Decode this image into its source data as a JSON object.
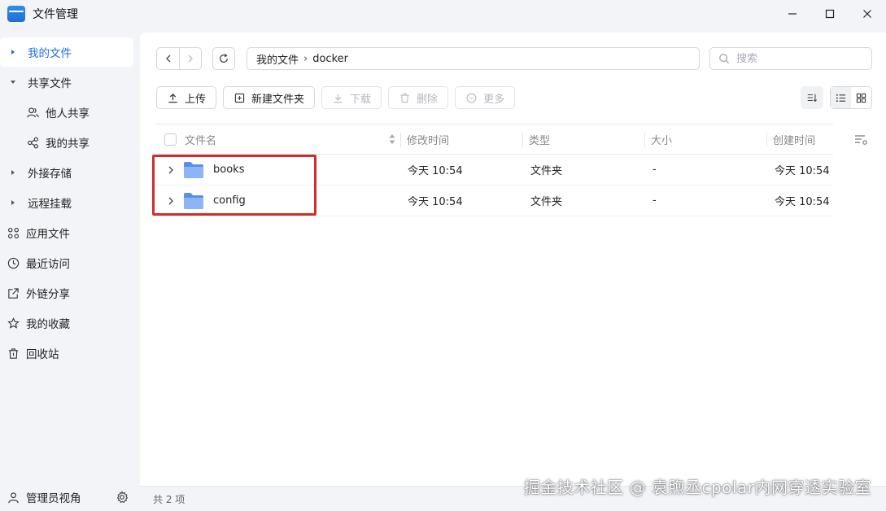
{
  "window": {
    "title": "文件管理",
    "controls": [
      "minimize",
      "maximize",
      "close"
    ]
  },
  "sidebar": {
    "items": [
      {
        "label": "我的文件",
        "icon": "caret-right-icon",
        "active": true
      },
      {
        "label": "共享文件",
        "icon": "caret-down-icon"
      },
      {
        "label": "他人共享",
        "icon": "users-icon",
        "sub": true
      },
      {
        "label": "我的共享",
        "icon": "share-icon",
        "sub": true
      },
      {
        "label": "外接存储",
        "icon": "caret-right-icon"
      },
      {
        "label": "远程挂载",
        "icon": "caret-right-icon"
      },
      {
        "label": "应用文件",
        "icon": "apps-icon"
      },
      {
        "label": "最近访问",
        "icon": "clock-icon"
      },
      {
        "label": "外链分享",
        "icon": "external-link-icon"
      },
      {
        "label": "我的收藏",
        "icon": "star-icon"
      },
      {
        "label": "回收站",
        "icon": "trash-icon"
      }
    ],
    "footer": {
      "label": "管理员视角",
      "icon": "admin-icon",
      "settings_icon": "gear-icon"
    }
  },
  "toolbar": {
    "path": {
      "root": "我的文件",
      "current": "docker"
    },
    "search_placeholder": "搜索",
    "actions": {
      "upload": "上传",
      "new_folder": "新建文件夹",
      "download": "下载",
      "delete": "删除",
      "more": "更多"
    }
  },
  "table": {
    "headers": {
      "name": "文件名",
      "modified": "修改时间",
      "type": "类型",
      "size": "大小",
      "created": "创建时间"
    },
    "rows": [
      {
        "name": "books",
        "modified": "今天 10:54",
        "type": "文件夹",
        "size": "-",
        "created": "今天 10:54"
      },
      {
        "name": "config",
        "modified": "今天 10:54",
        "type": "文件夹",
        "size": "-",
        "created": "今天 10:54"
      }
    ]
  },
  "status": {
    "count": "共 2 项"
  },
  "watermark": "掘金技术社区 @ 袁煦丞cpolar内网穿透实验室",
  "colors": {
    "accent": "#1e6fd9",
    "highlight": "#d42c2c",
    "folder": "#7fa9f0"
  }
}
